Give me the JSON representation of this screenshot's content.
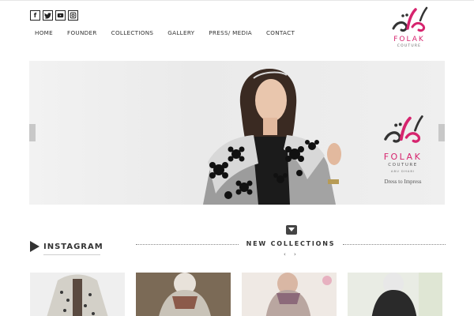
{
  "social": {
    "facebook": "f",
    "twitter": "t",
    "youtube": "▶",
    "instagram": "◎"
  },
  "nav": {
    "items": [
      "HOME",
      "FOUNDER",
      "COLLECTIONS",
      "GALLERY",
      "PRESS/ MEDIA",
      "CONTACT"
    ]
  },
  "logo": {
    "brand": "FOLAK",
    "sub": "COUTURE",
    "color": "#d6246e"
  },
  "hero": {
    "brand": "FOLAK",
    "sub": "COUTURE",
    "sub2": "ABU DHABI",
    "tagline": "Dress to Impress"
  },
  "sections": {
    "instagram": "INSTAGRAM",
    "new_collections": "NEW COLLECTIONS",
    "prev": "‹",
    "next": "›"
  }
}
